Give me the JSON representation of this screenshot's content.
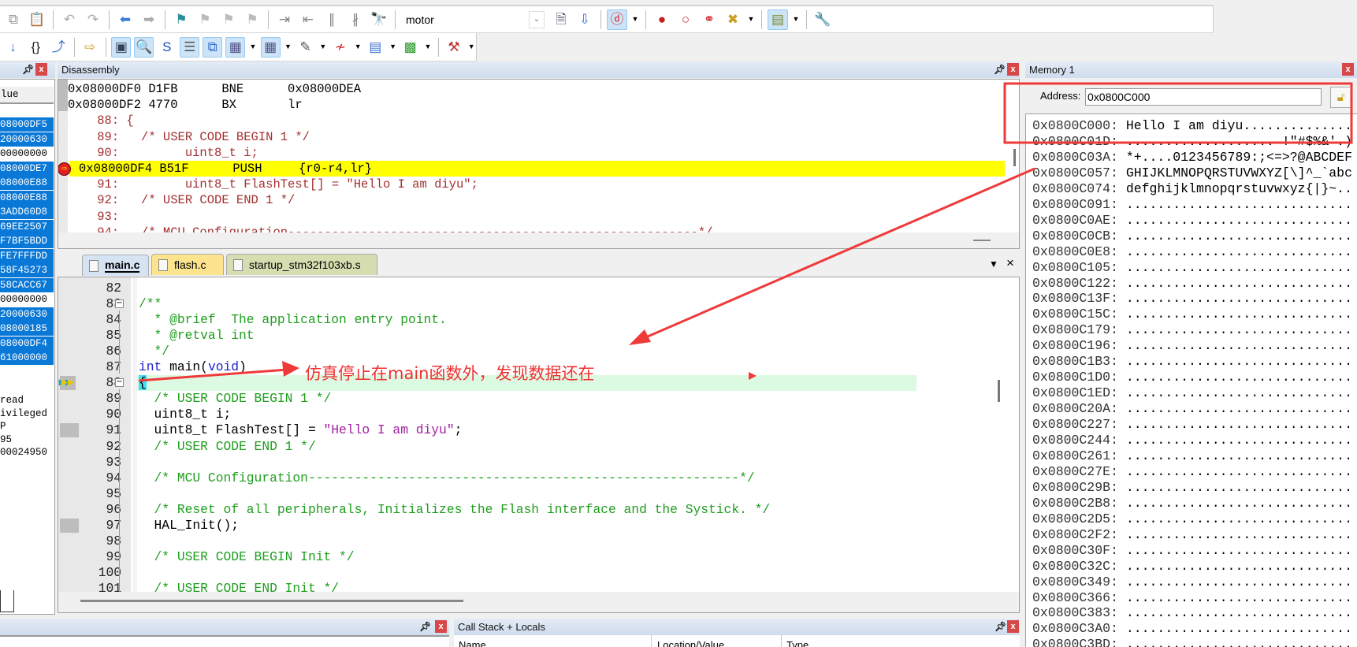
{
  "toolbar1": {
    "icons": [
      "copy-icon",
      "paste-icon",
      "undo-icon",
      "redo-icon",
      "navigate-back-icon",
      "navigate-forward-icon",
      "bookmark-icon",
      "prev-bookmark-icon",
      "next-bookmark-icon",
      "clear-bookmarks-icon",
      "indent-icon",
      "unindent-icon",
      "comment-icon",
      "uncomment-icon",
      "find-in-files-icon"
    ],
    "target_combo_value": "motor",
    "right_icons": [
      "find-icon",
      "incremental-find-icon",
      "debug-session-icon",
      "insert-breakpoint-icon",
      "enable-breakpoint-icon",
      "disable-all-breakpoints-icon",
      "kill-all-breakpoints-icon",
      "window-layout-icon",
      "configure-icon"
    ]
  },
  "toolbar2": {
    "icons": [
      "step-icon",
      "step-over-icon",
      "step-out-icon",
      "run-to-cursor-icon",
      "command-window-icon",
      "disassembly-window-icon",
      "symbols-window-icon",
      "registers-window-icon",
      "call-stack-window-icon",
      "watch-windows-icon",
      "memory-windows-icon",
      "serial-windows-icon",
      "analysis-windows-icon",
      "trace-windows-icon",
      "system-viewer-icon",
      "toolbox-icon"
    ]
  },
  "left_panel": {
    "header": "lue",
    "values": [
      {
        "v": "08000DF5",
        "hl": true
      },
      {
        "v": "20000630",
        "hl": true
      },
      {
        "v": "00000000",
        "hl": false
      },
      {
        "v": "08000DE7",
        "hl": true
      },
      {
        "v": "08000E88",
        "hl": true
      },
      {
        "v": "08000E88",
        "hl": true
      },
      {
        "v": "3ADD60D8",
        "hl": true
      },
      {
        "v": "69EE2507",
        "hl": true
      },
      {
        "v": "F7BF5BDD",
        "hl": true
      },
      {
        "v": "FE7FFFDD",
        "hl": true
      },
      {
        "v": "58F45273",
        "hl": true
      },
      {
        "v": "58CACC67",
        "hl": true
      },
      {
        "v": "00000000",
        "hl": false
      },
      {
        "v": "20000630",
        "hl": true
      },
      {
        "v": "08000185",
        "hl": true
      },
      {
        "v": "08000DF4",
        "hl": true
      },
      {
        "v": "61000000",
        "hl": true
      }
    ],
    "info": [
      "read",
      "ivileged",
      "P",
      "95",
      "00024950"
    ]
  },
  "disassembly": {
    "title": "Disassembly",
    "lines": [
      {
        "text": "0x08000DF0 D1FB      BNE      0x08000DEA",
        "kind": "asm"
      },
      {
        "text": "0x08000DF2 4770      BX       lr",
        "kind": "asm"
      },
      {
        "text": "    88: {",
        "kind": "src"
      },
      {
        "text": "    89:   /* USER CODE BEGIN 1 */",
        "kind": "src"
      },
      {
        "text": "    90:         uint8_t i;",
        "kind": "src"
      },
      {
        "text": "0x08000DF4 B51F      PUSH     {r0-r4,lr}",
        "kind": "cur"
      },
      {
        "text": "    91:         uint8_t FlashTest[] = \"Hello I am diyu\";",
        "kind": "src"
      },
      {
        "text": "    92:   /* USER CODE END 1 */",
        "kind": "src"
      },
      {
        "text": "    93:",
        "kind": "src"
      },
      {
        "text": "    94:   /* MCU Configuration--------------------------------------------------------*/",
        "kind": "src"
      }
    ]
  },
  "editor": {
    "tabs": [
      {
        "label": "main.c",
        "active": true,
        "color": "#d5e3f3"
      },
      {
        "label": "flash.c",
        "active": false,
        "color": "#fce48e"
      },
      {
        "label": "startup_stm32f103xb.s",
        "active": false,
        "color": "#d6ddb0"
      }
    ],
    "current_line": 88,
    "lines": [
      {
        "n": "82",
        "tokens": []
      },
      {
        "n": "83",
        "fold": true,
        "tokens": [
          {
            "t": "/**",
            "c": "comment"
          }
        ]
      },
      {
        "n": "84",
        "tokens": [
          {
            "t": "  * @brief  The application entry point.",
            "c": "comment"
          }
        ]
      },
      {
        "n": "85",
        "tokens": [
          {
            "t": "  * @retval int",
            "c": "comment"
          }
        ]
      },
      {
        "n": "86",
        "tokens": [
          {
            "t": "  */",
            "c": "comment"
          }
        ]
      },
      {
        "n": "87",
        "tokens": [
          {
            "t": "int",
            "c": "keyword"
          },
          {
            "t": " main(",
            "c": "plain"
          },
          {
            "t": "void",
            "c": "keyword"
          },
          {
            "t": ")",
            "c": "plain"
          }
        ]
      },
      {
        "n": "88",
        "fold": true,
        "tokens": [
          {
            "t": "{",
            "c": "plain"
          }
        ]
      },
      {
        "n": "89",
        "tokens": [
          {
            "t": "  /* USER CODE BEGIN 1 */",
            "c": "comment"
          }
        ]
      },
      {
        "n": "90",
        "tokens": [
          {
            "t": "  uint8_t i;",
            "c": "plain"
          }
        ]
      },
      {
        "n": "91",
        "mark": true,
        "tokens": [
          {
            "t": "  uint8_t FlashTest[] = ",
            "c": "plain"
          },
          {
            "t": "\"Hello I am diyu\"",
            "c": "string"
          },
          {
            "t": ";",
            "c": "plain"
          }
        ]
      },
      {
        "n": "92",
        "tokens": [
          {
            "t": "  /* USER CODE END 1 */",
            "c": "comment"
          }
        ]
      },
      {
        "n": "93",
        "tokens": []
      },
      {
        "n": "94",
        "tokens": [
          {
            "t": "  /* MCU Configuration--------------------------------------------------------*/",
            "c": "comment"
          }
        ]
      },
      {
        "n": "95",
        "tokens": []
      },
      {
        "n": "96",
        "tokens": [
          {
            "t": "  /* Reset of all peripherals, Initializes the Flash interface and the Systick. */",
            "c": "comment"
          }
        ]
      },
      {
        "n": "97",
        "mark": true,
        "tokens": [
          {
            "t": "  HAL_Init();",
            "c": "plain"
          }
        ]
      },
      {
        "n": "98",
        "tokens": []
      },
      {
        "n": "99",
        "tokens": [
          {
            "t": "  /* USER CODE BEGIN Init */",
            "c": "comment"
          }
        ]
      },
      {
        "n": "100",
        "tokens": []
      },
      {
        "n": "101",
        "tokens": [
          {
            "t": "  /* USER CODE END Init */",
            "c": "comment"
          }
        ]
      }
    ]
  },
  "memory": {
    "title": "Memory 1",
    "address_label": "Address:",
    "address_value": "0x0800C000",
    "rows": [
      {
        "addr": "0x0800C000:",
        "data": "Hello I am diyu.............."
      },
      {
        "addr": "0x0800C01D:",
        "data": "................... !\"#$%&'.)"
      },
      {
        "addr": "0x0800C03A:",
        "data": "*+....0123456789:;<=>?@ABCDEF"
      },
      {
        "addr": "0x0800C057:",
        "data": "GHIJKLMNOPQRSTUVWXYZ[\\]^_`abc"
      },
      {
        "addr": "0x0800C074:",
        "data": "defghijklmnopqrstuvwxyz{|}~.."
      },
      {
        "addr": "0x0800C091:",
        "data": "............................."
      },
      {
        "addr": "0x0800C0AE:",
        "data": "............................."
      },
      {
        "addr": "0x0800C0CB:",
        "data": "............................."
      },
      {
        "addr": "0x0800C0E8:",
        "data": "............................."
      },
      {
        "addr": "0x0800C105:",
        "data": "............................."
      },
      {
        "addr": "0x0800C122:",
        "data": "............................."
      },
      {
        "addr": "0x0800C13F:",
        "data": "............................."
      },
      {
        "addr": "0x0800C15C:",
        "data": "............................."
      },
      {
        "addr": "0x0800C179:",
        "data": "............................."
      },
      {
        "addr": "0x0800C196:",
        "data": "............................."
      },
      {
        "addr": "0x0800C1B3:",
        "data": "............................."
      },
      {
        "addr": "0x0800C1D0:",
        "data": "............................."
      },
      {
        "addr": "0x0800C1ED:",
        "data": "............................."
      },
      {
        "addr": "0x0800C20A:",
        "data": "............................."
      },
      {
        "addr": "0x0800C227:",
        "data": "............................."
      },
      {
        "addr": "0x0800C244:",
        "data": "............................."
      },
      {
        "addr": "0x0800C261:",
        "data": "............................."
      },
      {
        "addr": "0x0800C27E:",
        "data": "............................."
      },
      {
        "addr": "0x0800C29B:",
        "data": "............................."
      },
      {
        "addr": "0x0800C2B8:",
        "data": "............................."
      },
      {
        "addr": "0x0800C2D5:",
        "data": "............................."
      },
      {
        "addr": "0x0800C2F2:",
        "data": "............................."
      },
      {
        "addr": "0x0800C30F:",
        "data": "............................."
      },
      {
        "addr": "0x0800C32C:",
        "data": "............................."
      },
      {
        "addr": "0x0800C349:",
        "data": "............................."
      },
      {
        "addr": "0x0800C366:",
        "data": "............................."
      },
      {
        "addr": "0x0800C383:",
        "data": "............................."
      },
      {
        "addr": "0x0800C3A0:",
        "data": "............................."
      },
      {
        "addr": "0x0800C3BD:",
        "data": "............................."
      }
    ]
  },
  "call_stack": {
    "title": "Call Stack + Locals",
    "columns": [
      "Name",
      "Location/Value",
      "Type"
    ]
  },
  "annotation": {
    "text": "仿真停止在main函数外，发现数据还在",
    "color": "#f03030"
  },
  "colors": {
    "selection": "#0a78d7",
    "current_asm_line": "#ffff00",
    "current_src_line": "#dcfae2",
    "panel_header": "#d6e2f0"
  }
}
